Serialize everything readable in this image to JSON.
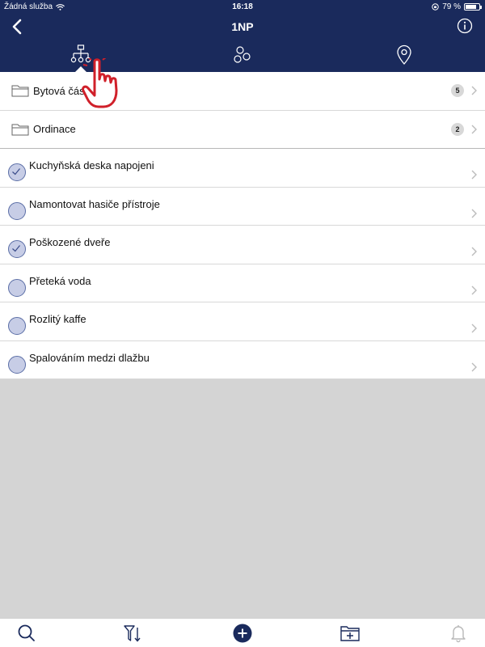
{
  "status_bar": {
    "carrier": "Žádná služba",
    "time": "16:18",
    "battery": "79 %",
    "battery_level": 0.79
  },
  "navbar": {
    "title": "1NP"
  },
  "tabs": [
    {
      "name": "hierarchy",
      "icon": "hierarchy-icon",
      "selected": true
    },
    {
      "name": "groups",
      "icon": "circles-icon",
      "selected": false
    },
    {
      "name": "location",
      "icon": "map-pin-icon",
      "selected": false
    }
  ],
  "folders": [
    {
      "label": "Bytová část",
      "count": "5"
    },
    {
      "label": "Ordinace",
      "count": "2"
    }
  ],
  "tasks": [
    {
      "label": "Kuchyňská deska napojeni",
      "checked": true
    },
    {
      "label": "Namontovat hasiče přístroje",
      "checked": false
    },
    {
      "label": "Poškozené dveře",
      "checked": true
    },
    {
      "label": "Přeteká voda",
      "checked": false
    },
    {
      "label": "Rozlitý kaffe",
      "checked": false
    },
    {
      "label": "Spalováním medzi dlažbu",
      "checked": false
    }
  ],
  "colors": {
    "header": "#1a2a5c",
    "accent": "#1a2a5c",
    "pointer": "#d0202a"
  }
}
